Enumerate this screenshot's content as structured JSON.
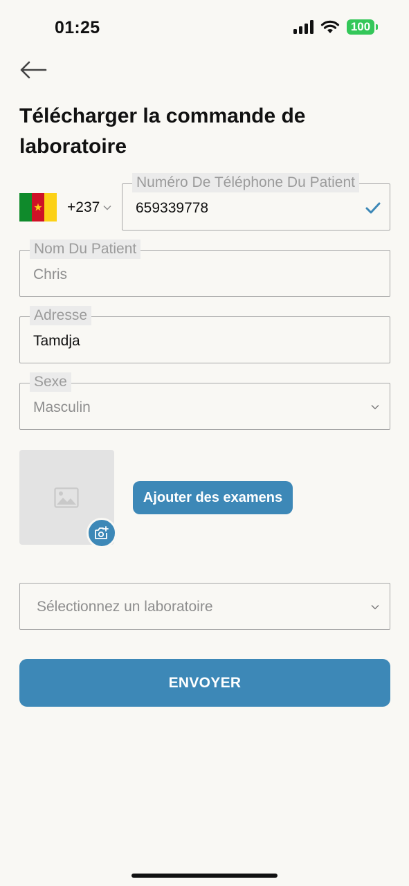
{
  "status_bar": {
    "time": "01:25",
    "battery": "100",
    "signal_icon": "signal-bars-icon",
    "wifi_icon": "wifi-icon"
  },
  "header": {
    "back_icon": "arrow-left-icon",
    "title": "Télécharger la commande de laboratoire"
  },
  "form": {
    "country_flag": "cameroon-flag",
    "dial_code": "+237",
    "phone": {
      "label": "Numéro De Téléphone Du Patient",
      "value": "659339778",
      "valid": true
    },
    "name": {
      "label": "Nom Du Patient",
      "value": "Chris"
    },
    "address": {
      "label": "Adresse",
      "value": "Tamdja"
    },
    "sex": {
      "label": "Sexe",
      "value": "Masculin"
    },
    "add_exams_label": "Ajouter des examens",
    "lab_select_placeholder": "Sélectionnez un laboratoire",
    "submit_label": "ENVOYER"
  },
  "colors": {
    "accent": "#3d88b7",
    "background": "#f9f8f4",
    "battery": "#34c759"
  }
}
